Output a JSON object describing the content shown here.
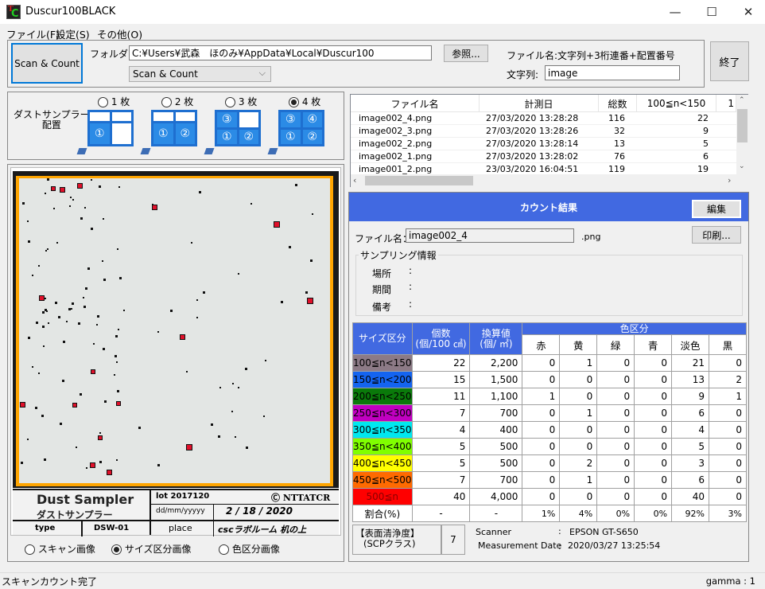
{
  "window": {
    "title": "Duscur100BLACK",
    "icon": "app-logo-icon",
    "controls": [
      "minimize-icon",
      "maximize-icon",
      "close-icon"
    ],
    "minimize": "—",
    "maximize": "☐",
    "close": "✕"
  },
  "menu": [
    {
      "label": "ファイル(F)"
    },
    {
      "label": "設定(S)"
    },
    {
      "label": "その他(O)"
    }
  ],
  "toolbar": {
    "scan_count_button": "Scan & Count",
    "folder_label": "フォルダ：",
    "folder_value": "C:¥Users¥武森　ほのみ¥AppData¥Local¥Duscur100",
    "mode_select": "Scan & Count",
    "browse_button": "参照...",
    "filename_rule": "ファイル名:文字列+3桁連番+配置番号",
    "string_label": "文字列:",
    "string_value": "image",
    "exit_button": "終了"
  },
  "layout": {
    "label_line1": "ダストサンプラー",
    "label_line2": "配置",
    "options": [
      {
        "label": "1 枚",
        "selected": false,
        "cells": [
          "",
          "",
          "①",
          ""
        ]
      },
      {
        "label": "2 枚",
        "selected": false,
        "cells": [
          "",
          "",
          "①",
          "②"
        ]
      },
      {
        "label": "3 枚",
        "selected": false,
        "cells": [
          "③",
          "",
          "①",
          "②"
        ]
      },
      {
        "label": "4 枚",
        "selected": true,
        "cells": [
          "③",
          "④",
          "①",
          "②"
        ]
      }
    ]
  },
  "file_list": {
    "columns": [
      "ファイル名",
      "計測日",
      "総数",
      "100≦n<150",
      "1"
    ],
    "rows": [
      {
        "name": "image002_4.png",
        "date": "27/03/2020 13:28:28",
        "total": "116",
        "c1": "22"
      },
      {
        "name": "image002_3.png",
        "date": "27/03/2020 13:28:26",
        "total": "32",
        "c1": "9"
      },
      {
        "name": "image002_2.png",
        "date": "27/03/2020 13:28:14",
        "total": "13",
        "c1": "5"
      },
      {
        "name": "image002_1.png",
        "date": "27/03/2020 13:28:02",
        "total": "76",
        "c1": "6"
      },
      {
        "name": "image001_2.png",
        "date": "23/03/2020 16:04:51",
        "total": "119",
        "c1": "19"
      }
    ]
  },
  "sampler_image": {
    "title_en": "Dust Sampler",
    "title_jp": "ダストサンプラー",
    "lot": "lot 2017120",
    "brand": "NTTATCR",
    "date_label": "dd/mm/yyyyy",
    "date_value": "2 / 18 / 2020",
    "type_label": "type",
    "type_value": "DSW-01",
    "place_label": "place",
    "place_value": "cscラボルーム 机の上",
    "view_options": [
      {
        "label": "スキャン画像",
        "selected": false
      },
      {
        "label": "サイズ区分画像",
        "selected": true
      },
      {
        "label": "色区分画像",
        "selected": false
      }
    ]
  },
  "result": {
    "header": "カウント結果",
    "edit_button": "編集",
    "print_button": "印刷...",
    "filename_label": "ファイル名：",
    "filename_value": "image002_4",
    "extension": ".png",
    "sampling_group": "サンプリング情報",
    "place_label": "場所",
    "period_label": "期間",
    "note_label": "備考",
    "colon": ":",
    "table": {
      "h_size": "サイズ区分",
      "h_count_1": "個数",
      "h_count_2": "(個/100 ㎠)",
      "h_conv_1": "換算値",
      "h_conv_2": "(個/ ㎡)",
      "h_color": "色区分",
      "color_cols": [
        "赤",
        "黄",
        "緑",
        "青",
        "淡色",
        "黒"
      ],
      "rows": [
        {
          "label": "100≦n<150",
          "bg": "#8c7a86",
          "fg": "#000000",
          "count": "22",
          "conv": "2,200",
          "colors": [
            "0",
            "1",
            "0",
            "0",
            "21",
            "0"
          ]
        },
        {
          "label": "150≦n<200",
          "bg": "#1464f0",
          "fg": "#000000",
          "count": "15",
          "conv": "1,500",
          "colors": [
            "0",
            "0",
            "0",
            "0",
            "13",
            "2"
          ]
        },
        {
          "label": "200≦n<250",
          "bg": "#0a7a0a",
          "fg": "#000000",
          "count": "11",
          "conv": "1,100",
          "colors": [
            "1",
            "0",
            "0",
            "0",
            "9",
            "1"
          ]
        },
        {
          "label": "250≦n<300",
          "bg": "#c000c0",
          "fg": "#000000",
          "count": "7",
          "conv": "700",
          "colors": [
            "0",
            "1",
            "0",
            "0",
            "6",
            "0"
          ]
        },
        {
          "label": "300≦n<350",
          "bg": "#00e8f0",
          "fg": "#000000",
          "count": "4",
          "conv": "400",
          "colors": [
            "0",
            "0",
            "0",
            "0",
            "4",
            "0"
          ]
        },
        {
          "label": "350≦n<400",
          "bg": "#80ff00",
          "fg": "#000000",
          "count": "5",
          "conv": "500",
          "colors": [
            "0",
            "0",
            "0",
            "0",
            "5",
            "0"
          ]
        },
        {
          "label": "400≦n<450",
          "bg": "#ffff00",
          "fg": "#000000",
          "count": "5",
          "conv": "500",
          "colors": [
            "0",
            "2",
            "0",
            "0",
            "3",
            "0"
          ]
        },
        {
          "label": "450≦n<500",
          "bg": "#ff6a00",
          "fg": "#000000",
          "count": "7",
          "conv": "700",
          "colors": [
            "0",
            "1",
            "0",
            "0",
            "6",
            "0"
          ]
        },
        {
          "label": "500≦n",
          "bg": "#ff0000",
          "fg": "#8a0000",
          "count": "40",
          "conv": "4,000",
          "colors": [
            "0",
            "0",
            "0",
            "0",
            "40",
            "0"
          ]
        }
      ],
      "ratio_row": {
        "label": "割合(%)",
        "count": "-",
        "conv": "-",
        "colors": [
          "1%",
          "4%",
          "0%",
          "0%",
          "92%",
          "3%"
        ]
      }
    },
    "cleanliness_label_1": "【表面清浄度】",
    "cleanliness_label_2": "(SCPクラス)",
    "cleanliness_value": "7",
    "scanner_label": "Scanner",
    "scanner_value": "EPSON GT-S650",
    "mdate_label": "Measurement Date",
    "mdate_value": "2020/03/27 13:25:54"
  },
  "status": {
    "message": "スキャンカウント完了",
    "gamma": "gamma : 1"
  },
  "colors": {
    "accent_blue": "#4169e1",
    "focus_border": "#0078d7",
    "frame_orange": "#ffa500"
  }
}
